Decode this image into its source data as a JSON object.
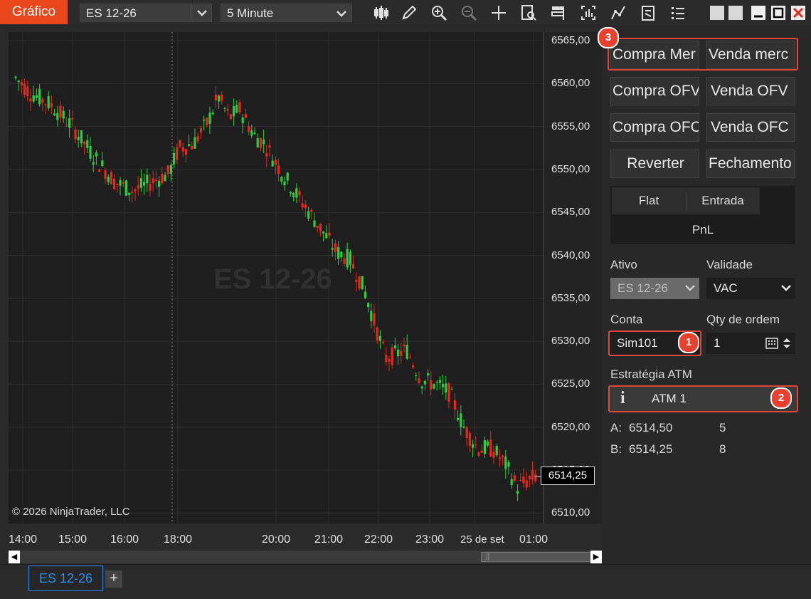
{
  "toolbar": {
    "app_title": "Gráfico",
    "instrument": "ES 12-26",
    "interval": "5 Minute",
    "icons": [
      "bar-chart-icon",
      "pencil-icon",
      "zoom-in-icon",
      "zoom-out-icon",
      "crosshair-icon",
      "data-box-icon",
      "flag-icon",
      "strategy-icon",
      "indicator-icon",
      "properties-icon",
      "list-icon"
    ]
  },
  "chart": {
    "watermark": "ES 12-26",
    "copyright": "© 2026 NinjaTrader, LLC",
    "last_price": "6514,25",
    "price_ticks": [
      "6565,00",
      "6560,00",
      "6555,00",
      "6550,00",
      "6545,00",
      "6540,00",
      "6535,00",
      "6530,00",
      "6525,00",
      "6520,00",
      "6515,00",
      "6510,00"
    ],
    "time_ticks": [
      "14:00",
      "15:00",
      "16:00",
      "18:00",
      "20:00",
      "21:00",
      "22:00",
      "23:00",
      "25 de set",
      "01:00"
    ],
    "colors": {
      "up": "#2ecc40",
      "down": "#e8261c",
      "background": "#1e1e1e"
    }
  },
  "tabs": {
    "active": "ES 12-26",
    "add": "+"
  },
  "panel": {
    "buttons": {
      "buy_market": "Compra Mer",
      "sell_market": "Venda merc",
      "buy_ofv": "Compra OFV",
      "sell_ofv": "Venda OFV",
      "buy_ofc": "Compra OFC",
      "sell_ofc": "Venda OFC",
      "reverse": "Reverter",
      "close": "Fechamento"
    },
    "position": {
      "flat": "Flat",
      "entry": "Entrada",
      "pnl": "PnL"
    },
    "ativo_label": "Ativo",
    "ativo_value": "ES 12-26",
    "validade_label": "Validade",
    "validade_value": "VAC",
    "conta_label": "Conta",
    "conta_value": "Sim101",
    "qty_label": "Qty de ordem",
    "qty_value": "1",
    "atm_label": "Estratégia ATM",
    "atm_value": "ATM 1",
    "ask_label": "A:",
    "ask_price": "6514,50",
    "ask_size": "5",
    "bid_label": "B:",
    "bid_price": "6514,25",
    "bid_size": "8",
    "badges": [
      "1",
      "2",
      "3"
    ]
  }
}
